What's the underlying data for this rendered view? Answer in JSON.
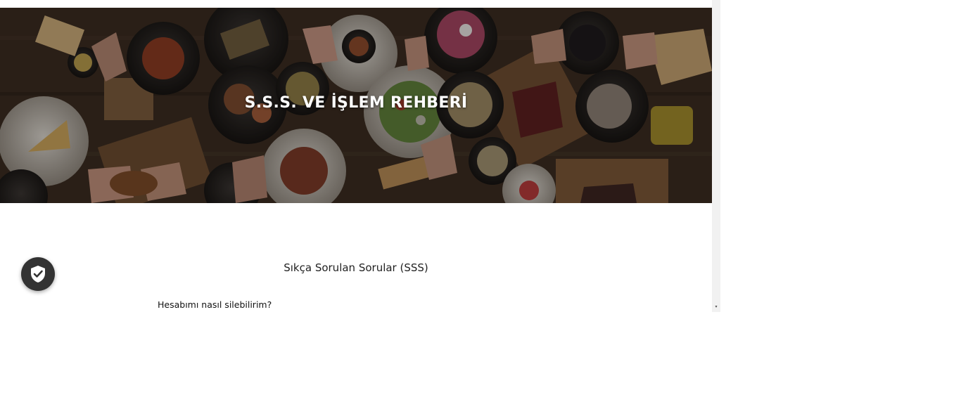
{
  "hero": {
    "title": "S.S.S. VE İŞLEM REHBERİ"
  },
  "faq": {
    "section_title": "Sıkça Sorulan Sorular (SSS)",
    "questions": [
      {
        "label": "Hesabımı nasıl silebilirim?"
      }
    ]
  },
  "privacy_badge": {
    "icon": "shield-check-icon"
  },
  "scrollbar": {
    "down_arrow": "▾"
  },
  "colors": {
    "badge_bg": "#333333",
    "hero_overlay": "#2b2119",
    "scrollbar_track": "#f1f1f1"
  }
}
